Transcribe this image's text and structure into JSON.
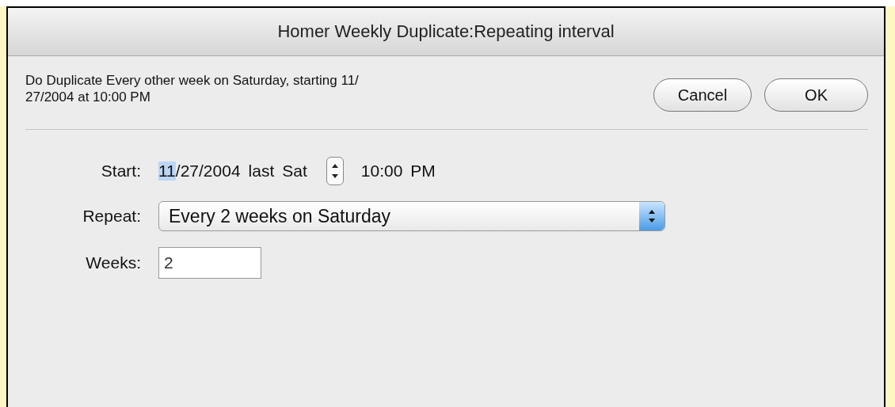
{
  "window": {
    "title": "Homer Weekly Duplicate:Repeating interval"
  },
  "description_lines": [
    "Do Duplicate Every other week on Saturday, starting 11/",
    "27/2004 at 10:00 PM"
  ],
  "buttons": [
    {
      "label": "Cancel",
      "default": false
    },
    {
      "label": "OK",
      "default": false
    }
  ],
  "start": {
    "label": "Start:",
    "date_segments": [
      {
        "text": "11",
        "selected": true
      },
      {
        "text": "/27/2004",
        "selected": false
      }
    ],
    "relative": "last",
    "weekday": "Sat",
    "time": "10:00",
    "ampm": "PM"
  },
  "repeat": {
    "label": "Repeat:",
    "value": "Every 2 weeks on Saturday"
  },
  "weeks": {
    "label": "Weeks:",
    "value": "2"
  }
}
